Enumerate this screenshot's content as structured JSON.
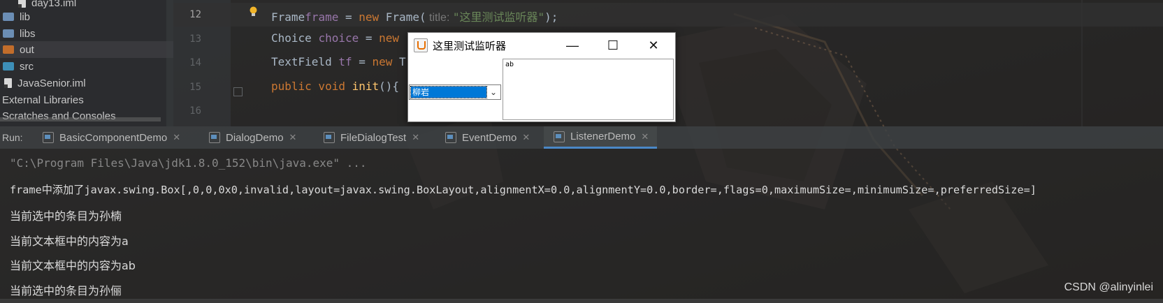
{
  "project_tree": {
    "items": [
      {
        "label": "day13.iml",
        "type": "file"
      },
      {
        "label": "lib",
        "type": "folder",
        "color": "#6b8eb5"
      },
      {
        "label": "libs",
        "type": "folder",
        "color": "#6b8eb5"
      },
      {
        "label": "out",
        "type": "folder",
        "color": "#c26d2b",
        "selected": true
      },
      {
        "label": "src",
        "type": "folder",
        "color": "#3d8fb8"
      },
      {
        "label": "JavaSenior.iml",
        "type": "file"
      },
      {
        "label": "External Libraries",
        "type": "section"
      },
      {
        "label": "Scratches and Consoles",
        "type": "section"
      }
    ]
  },
  "editor": {
    "line_numbers": [
      "12",
      "13",
      "14",
      "15",
      "16"
    ],
    "lines": {
      "l12": {
        "type": "Frame",
        "var": "frame",
        "eq": " = ",
        "new": "new",
        "ctor": " Frame(",
        "hint": " title: ",
        "str": "\"这里测试监听器\"",
        "end": ");"
      },
      "l13": {
        "type": "Choice",
        "var": "choice",
        "eq": " = ",
        "new": "new"
      },
      "l14": {
        "type": "TextField",
        "var": "tf",
        "eq": " = ",
        "new": "new",
        "rest": " T"
      },
      "l15": {
        "kw1": "public",
        "kw2": " void",
        "fn": " init",
        "rest": "(){"
      }
    }
  },
  "awt_window": {
    "title": "这里测试监听器",
    "minimize": "—",
    "maximize": "☐",
    "close": "✕",
    "choice_value": "柳岩",
    "choice_arrow": "⌄",
    "text_value": "ab"
  },
  "run": {
    "label": "Run:",
    "tabs": [
      {
        "label": "BasicComponentDemo"
      },
      {
        "label": "DialogDemo"
      },
      {
        "label": "FileDialogTest"
      },
      {
        "label": "EventDemo"
      },
      {
        "label": "ListenerDemo",
        "active": true
      }
    ],
    "close_glyph": "✕"
  },
  "console": {
    "lines": [
      "\"C:\\Program Files\\Java\\jdk1.8.0_152\\bin\\java.exe\" ...",
      "frame中添加了javax.swing.Box[,0,0,0x0,invalid,layout=javax.swing.BoxLayout,alignmentX=0.0,alignmentY=0.0,border=,flags=0,maximumSize=,minimumSize=,preferredSize=]",
      "当前选中的条目为孙楠",
      "当前文本框中的内容为a",
      "当前文本框中的内容为ab",
      "当前选中的条目为孙俪"
    ]
  },
  "watermark": "CSDN @alinyinlei"
}
